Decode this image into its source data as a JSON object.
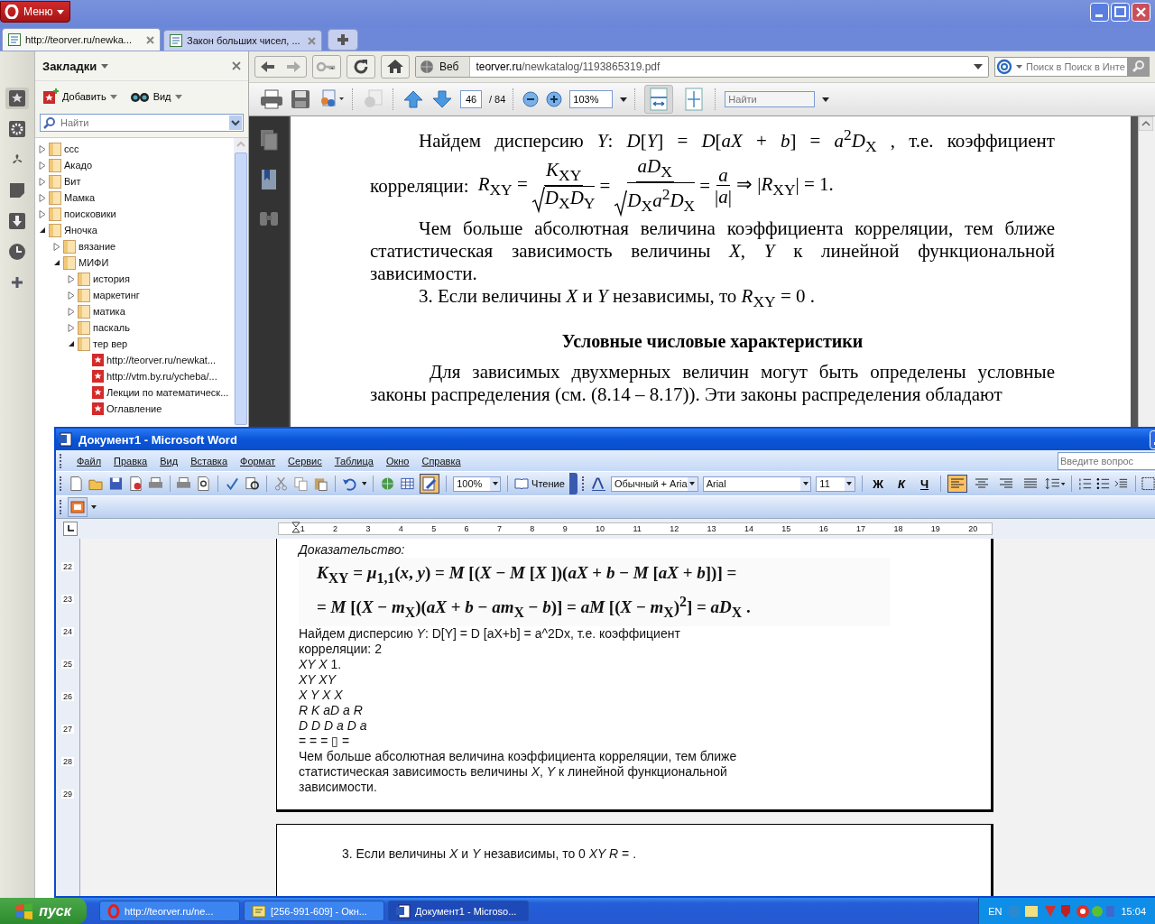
{
  "opera": {
    "menu_button": "Меню",
    "tabs": [
      {
        "title": "http://teorver.ru/newka...",
        "selected": true
      },
      {
        "title": "Закон больших чисел, ...",
        "selected": false
      }
    ],
    "panel_buttons": [
      {
        "kind": "bookmarks",
        "selected": true
      },
      {
        "kind": "gear",
        "selected": false
      },
      {
        "kind": "fan",
        "selected": false
      },
      {
        "kind": "note",
        "selected": false
      },
      {
        "kind": "download",
        "selected": false
      },
      {
        "kind": "clock",
        "selected": false
      },
      {
        "kind": "plus",
        "selected": false
      }
    ],
    "bookmarks": {
      "title": "Закладки",
      "add": "Добавить",
      "view": "Вид",
      "search_placeholder": "Найти",
      "tree": [
        {
          "label": "ccc",
          "kind": "folder",
          "expanded": false
        },
        {
          "label": "Акадо",
          "kind": "folder",
          "expanded": false
        },
        {
          "label": "Вит",
          "kind": "folder",
          "expanded": false
        },
        {
          "label": "Мамка",
          "kind": "folder",
          "expanded": false
        },
        {
          "label": "поисковики",
          "kind": "folder",
          "expanded": false
        },
        {
          "label": "Яночка",
          "kind": "folder",
          "expanded": true,
          "children": [
            {
              "label": "вязание",
              "kind": "folder",
              "expanded": false
            },
            {
              "label": "МИФИ",
              "kind": "folder",
              "expanded": true,
              "children": [
                {
                  "label": "история",
                  "kind": "folder",
                  "expanded": false
                },
                {
                  "label": "маркетинг",
                  "kind": "folder",
                  "expanded": false
                },
                {
                  "label": "матика",
                  "kind": "folder",
                  "expanded": false
                },
                {
                  "label": "паскаль",
                  "kind": "folder",
                  "expanded": false
                },
                {
                  "label": "тер вер",
                  "kind": "folder",
                  "expanded": true,
                  "children": [
                    {
                      "label": "http://teorver.ru/newkat...",
                      "kind": "bookmark"
                    },
                    {
                      "label": "http://vtm.by.ru/ycheba/...",
                      "kind": "bookmark"
                    },
                    {
                      "label": "Лекции по математическ...",
                      "kind": "bookmark"
                    },
                    {
                      "label": "Оглавление",
                      "kind": "bookmark"
                    }
                  ]
                }
              ]
            }
          ]
        }
      ]
    },
    "address": {
      "web_label": "Веб",
      "url_host": "teorver.ru",
      "url_path": "/newkatalog/1193865319.pdf"
    },
    "search": {
      "placeholder": "Поиск в Поиск в Инте"
    },
    "pdf_toolbar": {
      "page": "46",
      "pages": "/ 84",
      "zoom": "103%",
      "find_placeholder": "Найти",
      "view_buttons": [
        {
          "kind": "fit-width",
          "selected": true
        },
        {
          "kind": "fit-page",
          "selected": false
        }
      ]
    },
    "pdf": {
      "para1": "Найдем дисперсию *Y*:  *D*[*Y*] = *D*[*aX* + *b*] = *a*$^{2}$*D*$_{X}$ ,  т.е.  коэффициент",
      "formula_label": "корреляции:",
      "formula": [
        {
          "kind": "text",
          "text": "*R*$_{XY}$ ="
        },
        {
          "kind": "root_frac",
          "num": "*K*$_{XY}$",
          "den": "*D*$_{X}$*D*$_{Y}$"
        },
        {
          "kind": "text",
          "text": "="
        },
        {
          "kind": "root_frac",
          "num": "*aD*$_{X}$",
          "den": "*D*$_{X}$*a*$^{2}$*D*$_{X}$"
        },
        {
          "kind": "text",
          "text": "="
        },
        {
          "kind": "frac",
          "num": "*a*",
          "den": "|*a*|"
        },
        {
          "kind": "text",
          "text": "⇒ |*R*$_{XY}$| = 1."
        }
      ],
      "para2": "Чем больше абсолютная величина коэффициента корреляции, тем ближе статистическая зависимость величины *X*, *Y* к линейной функциональной зависимости.",
      "para3": "3. Если величины *X* и *Y* независимы, то  *R*$_{XY}$ = 0 .",
      "heading": "Условные числовые характеристики",
      "para4": "Для зависимых двухмерных величин могут быть определены условные законы распределения (см. (8.14 – 8.17)). Эти законы распределения обладают"
    }
  },
  "word": {
    "title": "Документ1 - Microsoft Word",
    "menu": [
      "Файл",
      "Правка",
      "Вид",
      "Вставка",
      "Формат",
      "Сервис",
      "Таблица",
      "Окно",
      "Справка"
    ],
    "help_placeholder": "Введите вопрос",
    "zoom": "100%",
    "reading": "Чтение",
    "style": "Обычный + Aria",
    "font": "Arial",
    "size": "11",
    "format_buttons": [
      "Ж",
      "К",
      "Ч"
    ],
    "map_button": {
      "selected": true
    },
    "alignment": [
      {
        "kind": "left",
        "selected": true
      },
      {
        "kind": "center",
        "selected": false
      },
      {
        "kind": "right",
        "selected": false
      },
      {
        "kind": "justify",
        "selected": false
      }
    ],
    "ruler_marks": [
      "1",
      "2",
      "3",
      "4",
      "5",
      "6",
      "7",
      "8",
      "9",
      "10",
      "11",
      "12",
      "13",
      "14",
      "15",
      "16",
      "17",
      "18",
      "19",
      "20"
    ],
    "vruler_marks": [
      "22",
      "23",
      "24",
      "25",
      "26",
      "27",
      "28",
      "29"
    ],
    "page1": {
      "proof": "Доказательство:",
      "formula_lines": [
        "*K*$_{XY}$ = *μ*$_{1,1}$(*x*, *y*) = *M* [(*X* − *M* [*X* ])(*aX* + *b* − *M* [*aX* + *b*])] =",
        "= *M* [(*X* − *m*$_{X}$)(*aX* + *b* − *am*$_{X}$ − *b*)] = *aM* [(*X* − *m*$_{X}$)$^{2}$] = *aD*$_{X}$ ."
      ],
      "lines": [
        "Найдем дисперсию *Y*: D[Y] = D [aX+b] = a^2Dx, т.е. коэффициент",
        "корреляции: 2",
        "*XY X* 1.",
        "*XY XY*",
        "*X Y X X*",
        "*R K aD a R*",
        "*D D D a D a*",
        "= = = ▯ =",
        "Чем больше абсолютная величина коэффициента корреляции, тем ближе",
        "статистическая зависимость величины *X*, *Y* к линейной функциональной",
        "зависимости."
      ]
    },
    "page2": {
      "line": "3. Если величины *X* и *Y* независимы, то 0 *XY R* = ."
    }
  },
  "taskbar": {
    "start": "пуск",
    "tasks": [
      {
        "title": "http://teorver.ru/ne...",
        "kind": "opera",
        "selected": false
      },
      {
        "title": "[256-991-609] - Окн...",
        "kind": "chat",
        "selected": false
      },
      {
        "title": "Документ1 - Microso...",
        "kind": "word",
        "selected": true
      }
    ],
    "language": "EN",
    "clock": "15:04"
  }
}
